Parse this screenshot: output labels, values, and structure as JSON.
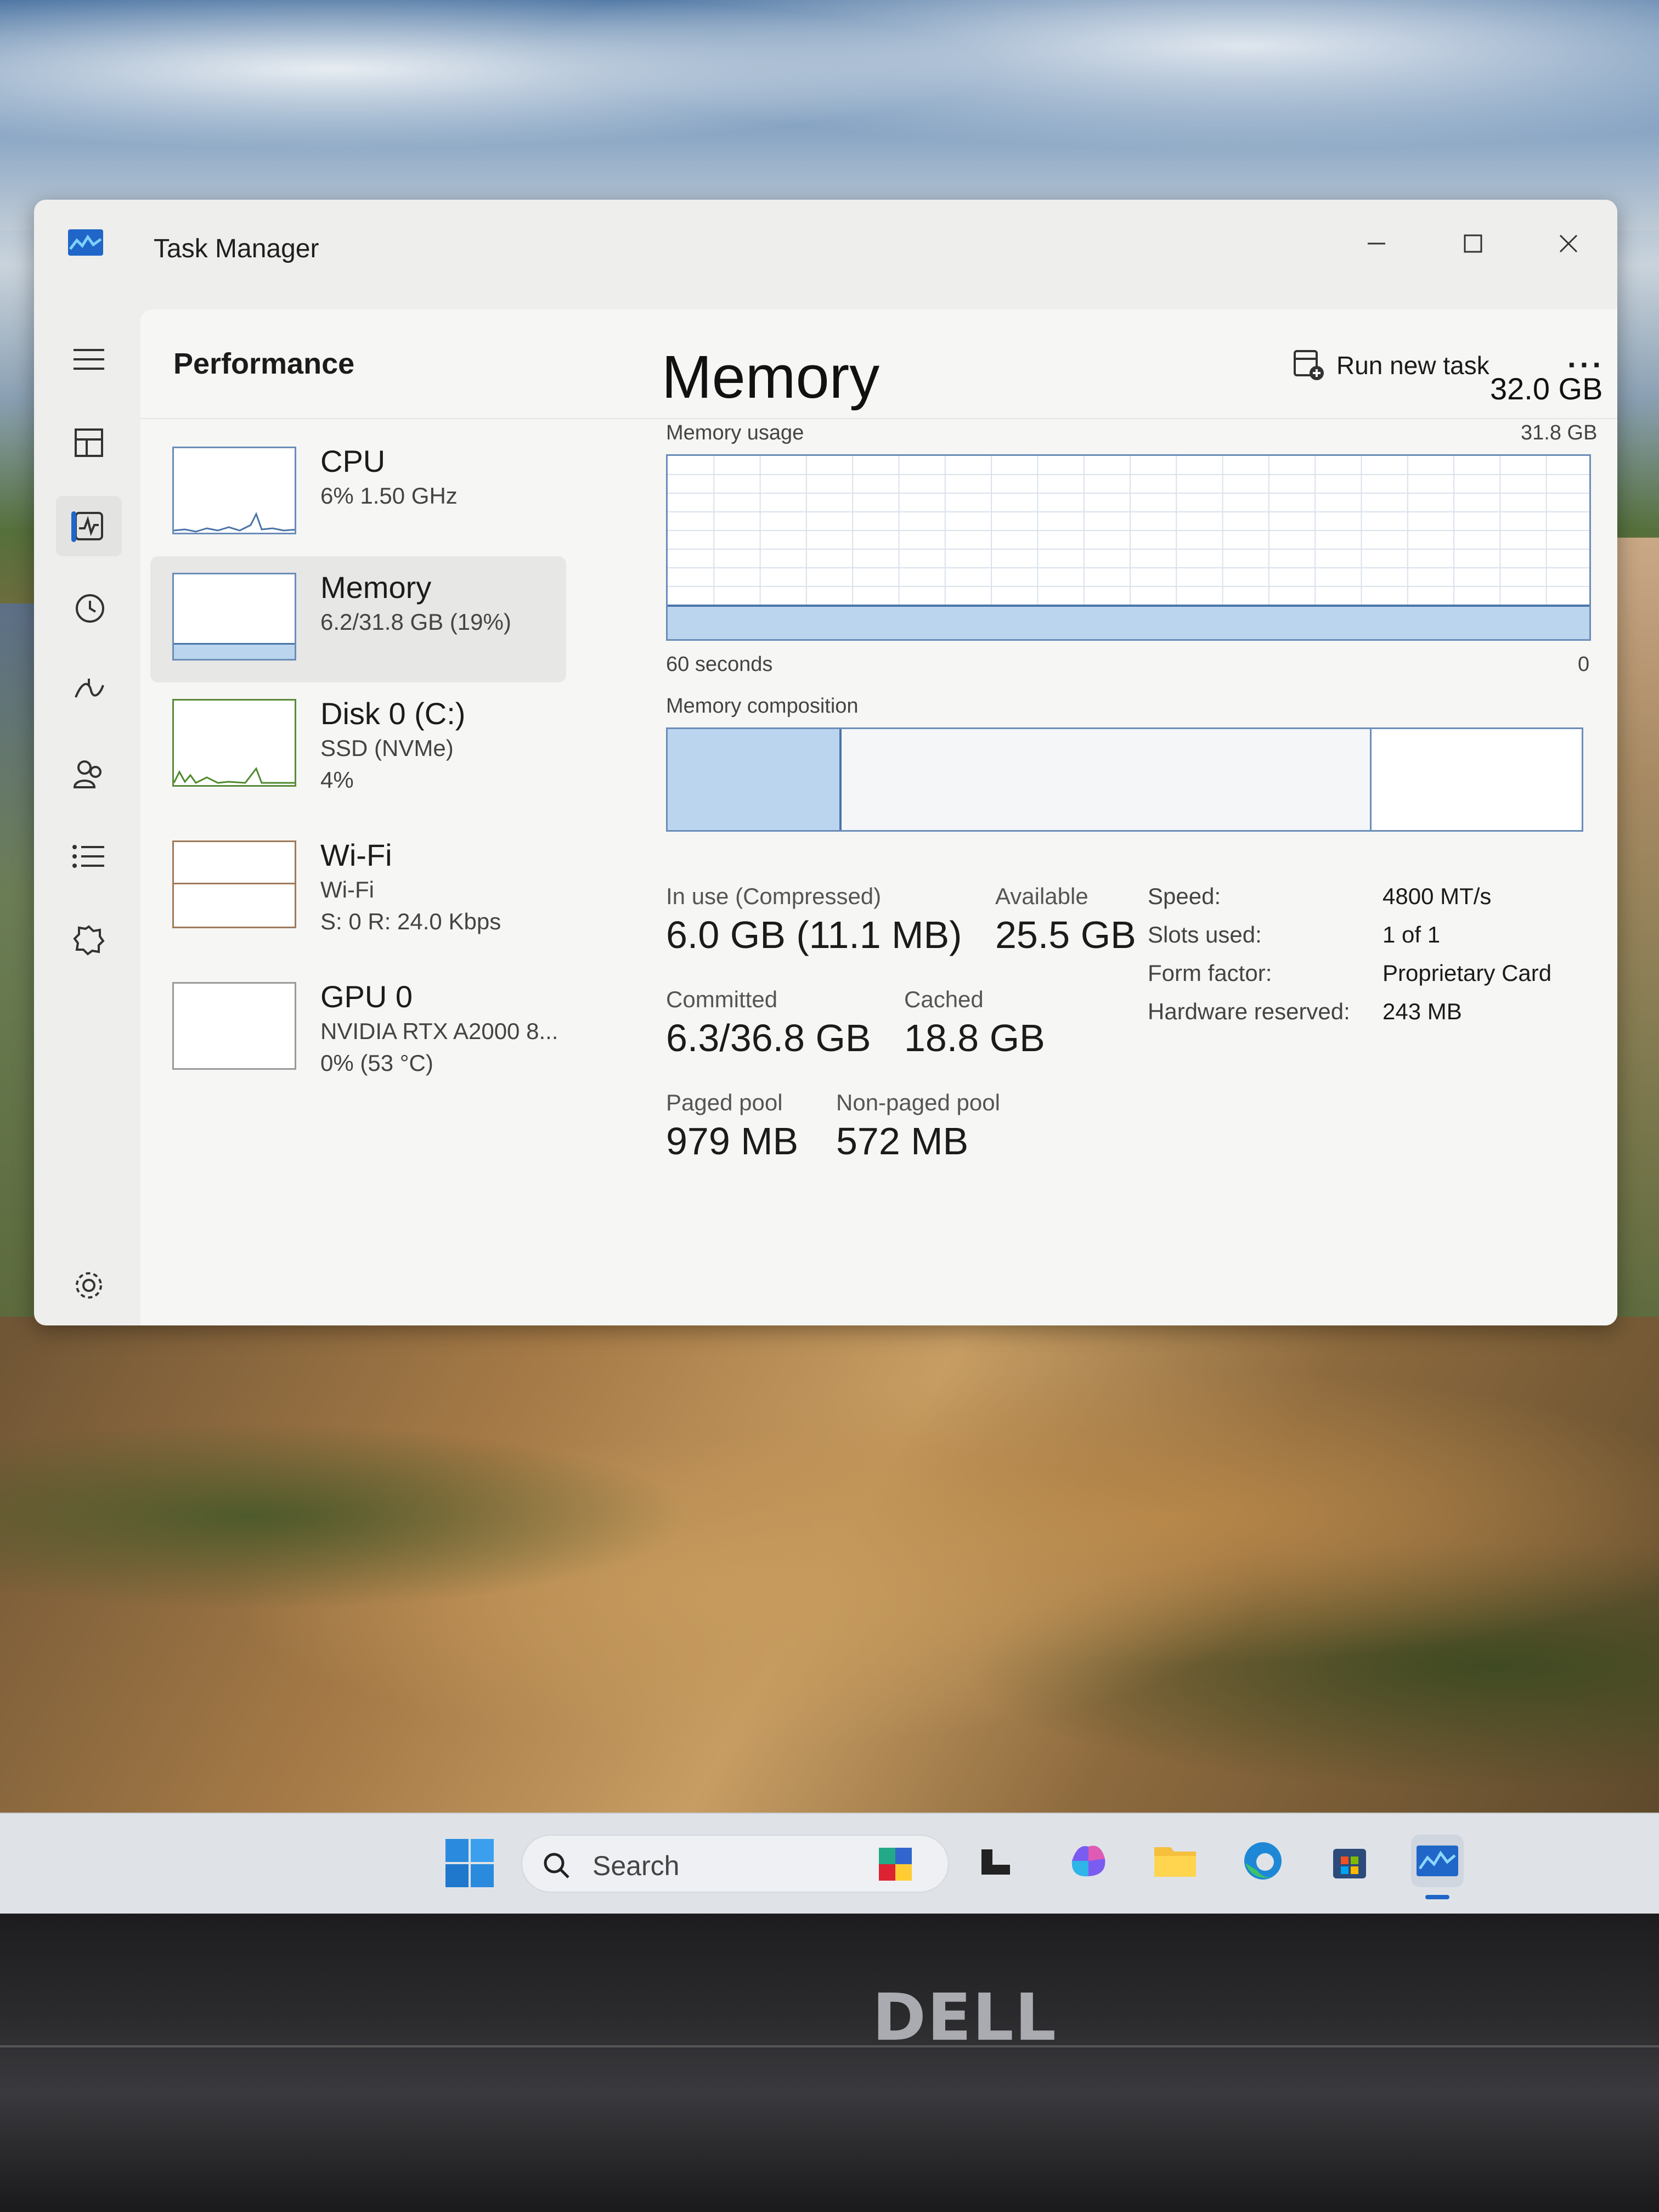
{
  "window": {
    "title": "Task Manager",
    "minimize_icon": "minimize-icon",
    "maximize_icon": "maximize-icon",
    "close_icon": "close-icon"
  },
  "nav": {
    "items": [
      {
        "name": "menu",
        "icon": "hamburger-icon"
      },
      {
        "name": "processes",
        "icon": "processes-icon"
      },
      {
        "name": "performance",
        "icon": "performance-icon",
        "active": true
      },
      {
        "name": "app-history",
        "icon": "history-icon"
      },
      {
        "name": "startup-apps",
        "icon": "startup-icon"
      },
      {
        "name": "users",
        "icon": "users-icon"
      },
      {
        "name": "details",
        "icon": "details-icon"
      },
      {
        "name": "services",
        "icon": "services-icon"
      },
      {
        "name": "settings",
        "icon": "gear-icon"
      }
    ]
  },
  "header": {
    "title": "Performance",
    "run_new_task": "Run new task",
    "more": "···"
  },
  "devices": [
    {
      "name": "CPU",
      "sub1": "6% 1.50 GHz"
    },
    {
      "name": "Memory",
      "sub1": "6.2/31.8 GB (19%)",
      "selected": true
    },
    {
      "name": "Disk 0 (C:)",
      "sub1": "SSD (NVMe)",
      "sub2": "4%"
    },
    {
      "name": "Wi-Fi",
      "sub1": "Wi-Fi",
      "sub2": "S: 0 R: 24.0 Kbps"
    },
    {
      "name": "GPU 0",
      "sub1": "NVIDIA RTX A2000 8...",
      "sub2": "0% (53 °C)"
    }
  ],
  "memory": {
    "title": "Memory",
    "total": "32.0 GB",
    "usage_label": "Memory usage",
    "usage_max": "31.8 GB",
    "time_label": "60 seconds",
    "time_zero": "0",
    "composition_label": "Memory composition",
    "usage_fraction": 0.19,
    "composition": {
      "in_use": 0.19,
      "modified": 0.003,
      "standby": 0.58,
      "free": 0.22
    },
    "stats": {
      "in_use_label": "In use (Compressed)",
      "in_use_value": "6.0 GB (11.1 MB)",
      "available_label": "Available",
      "available_value": "25.5 GB",
      "committed_label": "Committed",
      "committed_value": "6.3/36.8 GB",
      "cached_label": "Cached",
      "cached_value": "18.8 GB",
      "paged_label": "Paged pool",
      "paged_value": "979 MB",
      "nonpaged_label": "Non-paged pool",
      "nonpaged_value": "572 MB"
    },
    "specs": [
      {
        "label": "Speed:",
        "value": "4800 MT/s"
      },
      {
        "label": "Slots used:",
        "value": "1 of 1"
      },
      {
        "label": "Form factor:",
        "value": "Proprietary Card"
      },
      {
        "label": "Hardware reserved:",
        "value": "243 MB"
      }
    ]
  },
  "taskbar": {
    "search_placeholder": "Search",
    "apps": [
      "start-icon",
      "cube-app-icon",
      "file-explorer-dark-icon",
      "m365-icon",
      "folder-icon",
      "edge-icon",
      "store-icon",
      "task-manager-icon"
    ]
  },
  "bezel": {
    "brand": "DELL"
  },
  "colors": {
    "accent": "#1f66c8",
    "graph_line": "#6b8db8",
    "graph_fill": "#bcd5ef"
  }
}
